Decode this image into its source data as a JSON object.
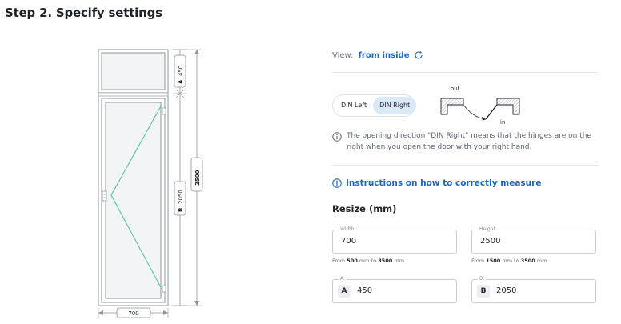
{
  "page": {
    "title": "Step 2. Specify settings"
  },
  "drawing": {
    "top_height_label": "A",
    "top_height": "450",
    "bottom_height_label": "B",
    "bottom_height": "2050",
    "total_height": "2500",
    "width": "700"
  },
  "settings": {
    "view_label": "View:",
    "view_value": "from inside",
    "din_left": "DIN Left",
    "din_right": "DIN Right",
    "diagram_out": "out",
    "diagram_in": "in",
    "info_text": "The opening direction \"DIN Right\" means that the hinges are on the right when you open the door with your right hand.",
    "instructions_link": "Instructions on how to correctly measure",
    "resize_title": "Resize (mm)",
    "width_field": {
      "legend": "Width:",
      "value": "700",
      "range_prefix": "From",
      "min": "500",
      "mid": "mm to",
      "max": "3500",
      "unit": "mm"
    },
    "height_field": {
      "legend": "Height:",
      "value": "2500",
      "range_prefix": "From",
      "min": "1500",
      "mid": "mm to",
      "max": "3500",
      "unit": "mm"
    },
    "a_field": {
      "legend": "A:",
      "badge": "A",
      "value": "450"
    },
    "b_field": {
      "legend": "B:",
      "badge": "B",
      "value": "2050"
    }
  },
  "colors": {
    "accent": "#1967c8",
    "glass": "#f3f4f6",
    "sash_line": "#5fc9a0"
  }
}
